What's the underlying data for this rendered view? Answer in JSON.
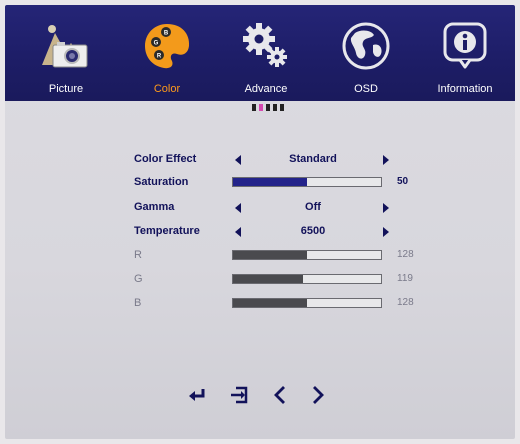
{
  "tabs": [
    {
      "label": "Picture",
      "icon": "picture-icon",
      "active": false
    },
    {
      "label": "Color",
      "icon": "palette-icon",
      "active": true
    },
    {
      "label": "Advance",
      "icon": "gears-icon",
      "active": false
    },
    {
      "label": "OSD",
      "icon": "globe-icon",
      "active": false
    },
    {
      "label": "Information",
      "icon": "info-icon",
      "active": false
    }
  ],
  "menu": {
    "color_effect": {
      "label": "Color Effect",
      "value": "Standard"
    },
    "saturation": {
      "label": "Saturation",
      "value": "50",
      "level": 0.5
    },
    "gamma": {
      "label": "Gamma",
      "value": "Off"
    },
    "temperature": {
      "label": "Temperature",
      "value": "6500"
    },
    "r": {
      "label": "R",
      "value": "128",
      "level": 0.5
    },
    "g": {
      "label": "G",
      "value": "119",
      "level": 0.47
    },
    "b": {
      "label": "B",
      "value": "128",
      "level": 0.5
    }
  },
  "colors": {
    "topbar": "#1d1d66",
    "accent": "#ff9a1a",
    "text": "#12125a",
    "page_indicator_active": "#d44ab0"
  },
  "nav_icons": [
    "enter-icon",
    "exit-icon",
    "chevron-left-icon",
    "chevron-right-icon"
  ]
}
